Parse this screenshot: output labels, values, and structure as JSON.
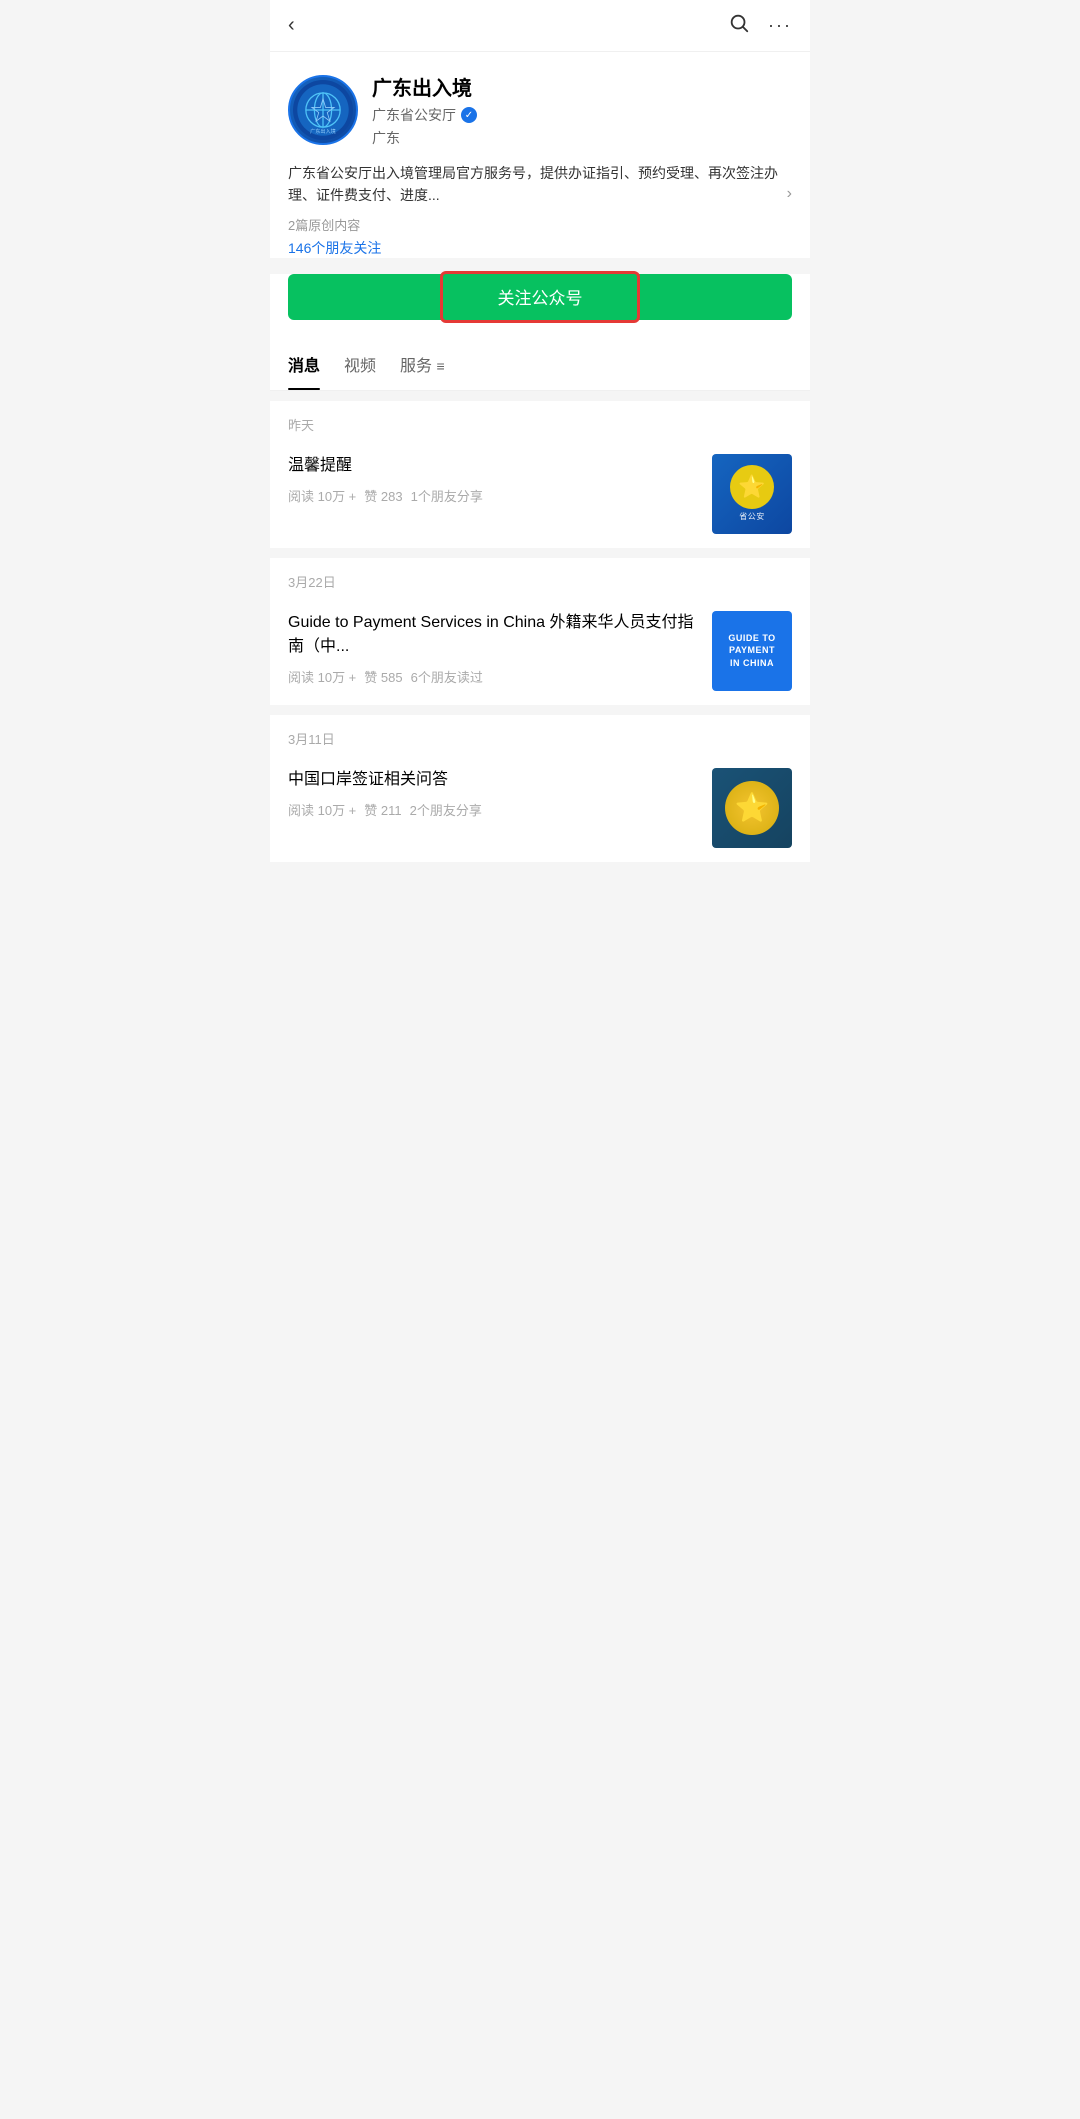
{
  "nav": {
    "back_icon": "‹",
    "search_icon": "🔍",
    "more_icon": "···"
  },
  "profile": {
    "name": "广东出入境",
    "sub_org": "广东省公安厅",
    "location": "广东",
    "description": "广东省公安厅出入境管理局官方服务号，提供办证指引、预约受理、再次签注办理、证件费支付、进度...",
    "original_content": "2篇原创内容",
    "friends_count": "146个朋友关注",
    "follow_button_label": "关注公众号"
  },
  "tabs": [
    {
      "label": "消息",
      "active": true
    },
    {
      "label": "视频",
      "active": false
    },
    {
      "label": "服务",
      "active": false
    }
  ],
  "sections": [
    {
      "date": "昨天",
      "articles": [
        {
          "title": "温馨提醒",
          "reads": "阅读 10万 +",
          "likes": "赞 283",
          "shares": "1个朋友分享",
          "thumb_type": "police"
        }
      ]
    },
    {
      "date": "3月22日",
      "articles": [
        {
          "title": "Guide to Payment Services in China 外籍来华人员支付指南（中...",
          "reads": "阅读 10万 +",
          "likes": "赞 585",
          "shares": "6个朋友读过",
          "thumb_type": "payment"
        }
      ]
    },
    {
      "date": "3月11日",
      "articles": [
        {
          "title": "中国口岸签证相关问答",
          "reads": "阅读 10万 +",
          "likes": "赞 211",
          "shares": "2个朋友分享",
          "thumb_type": "visa"
        }
      ]
    }
  ],
  "payment_thumb": {
    "line1": "GUIDE TO",
    "line2": "PAYMENT",
    "line3": "IN CHINA"
  }
}
